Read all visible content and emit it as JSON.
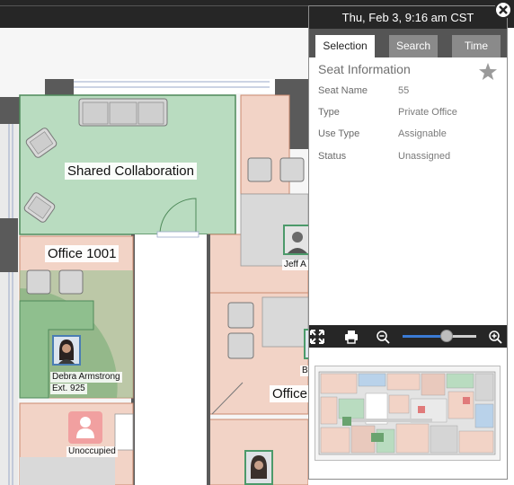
{
  "panel": {
    "datetime": "Thu, Feb 3, 9:16 am CST",
    "tabs": [
      {
        "label": "Selection",
        "active": true
      },
      {
        "label": "Search",
        "active": false
      },
      {
        "label": "Time",
        "active": false
      }
    ],
    "seat_info": {
      "title": "Seat Information",
      "fields": [
        {
          "label": "Seat Name",
          "value": "55"
        },
        {
          "label": "Type",
          "value": "Private Office"
        },
        {
          "label": "Use Type",
          "value": "Assignable"
        },
        {
          "label": "Status",
          "value": "Unassigned"
        }
      ]
    },
    "zoom_level": 0.6
  },
  "floorplan": {
    "rooms": {
      "shared": "Shared Collaboration",
      "office1001": "Office 1001",
      "office_partial": "Office"
    },
    "people": {
      "debra_name": "Debra Armstrong",
      "debra_ext": "Ext. 925",
      "jeff_partial": "Jeff A",
      "b_partial": "B",
      "unoccupied": "Unoccupied"
    }
  },
  "colors": {
    "shared_green": "#b9dcc0",
    "office_peach": "#f2d3c6",
    "highlight_green": "#8fbf8e",
    "dark_bar": "#262626",
    "accent_blue": "#3a7bd5",
    "wall": "#5a5a5a"
  },
  "icons": {
    "close": "close-icon",
    "star": "star-icon",
    "fit": "fit-screen-icon",
    "print": "print-icon",
    "zoom_out": "zoom-out-icon",
    "zoom_in": "zoom-in-icon",
    "unoccupied": "person-icon"
  }
}
